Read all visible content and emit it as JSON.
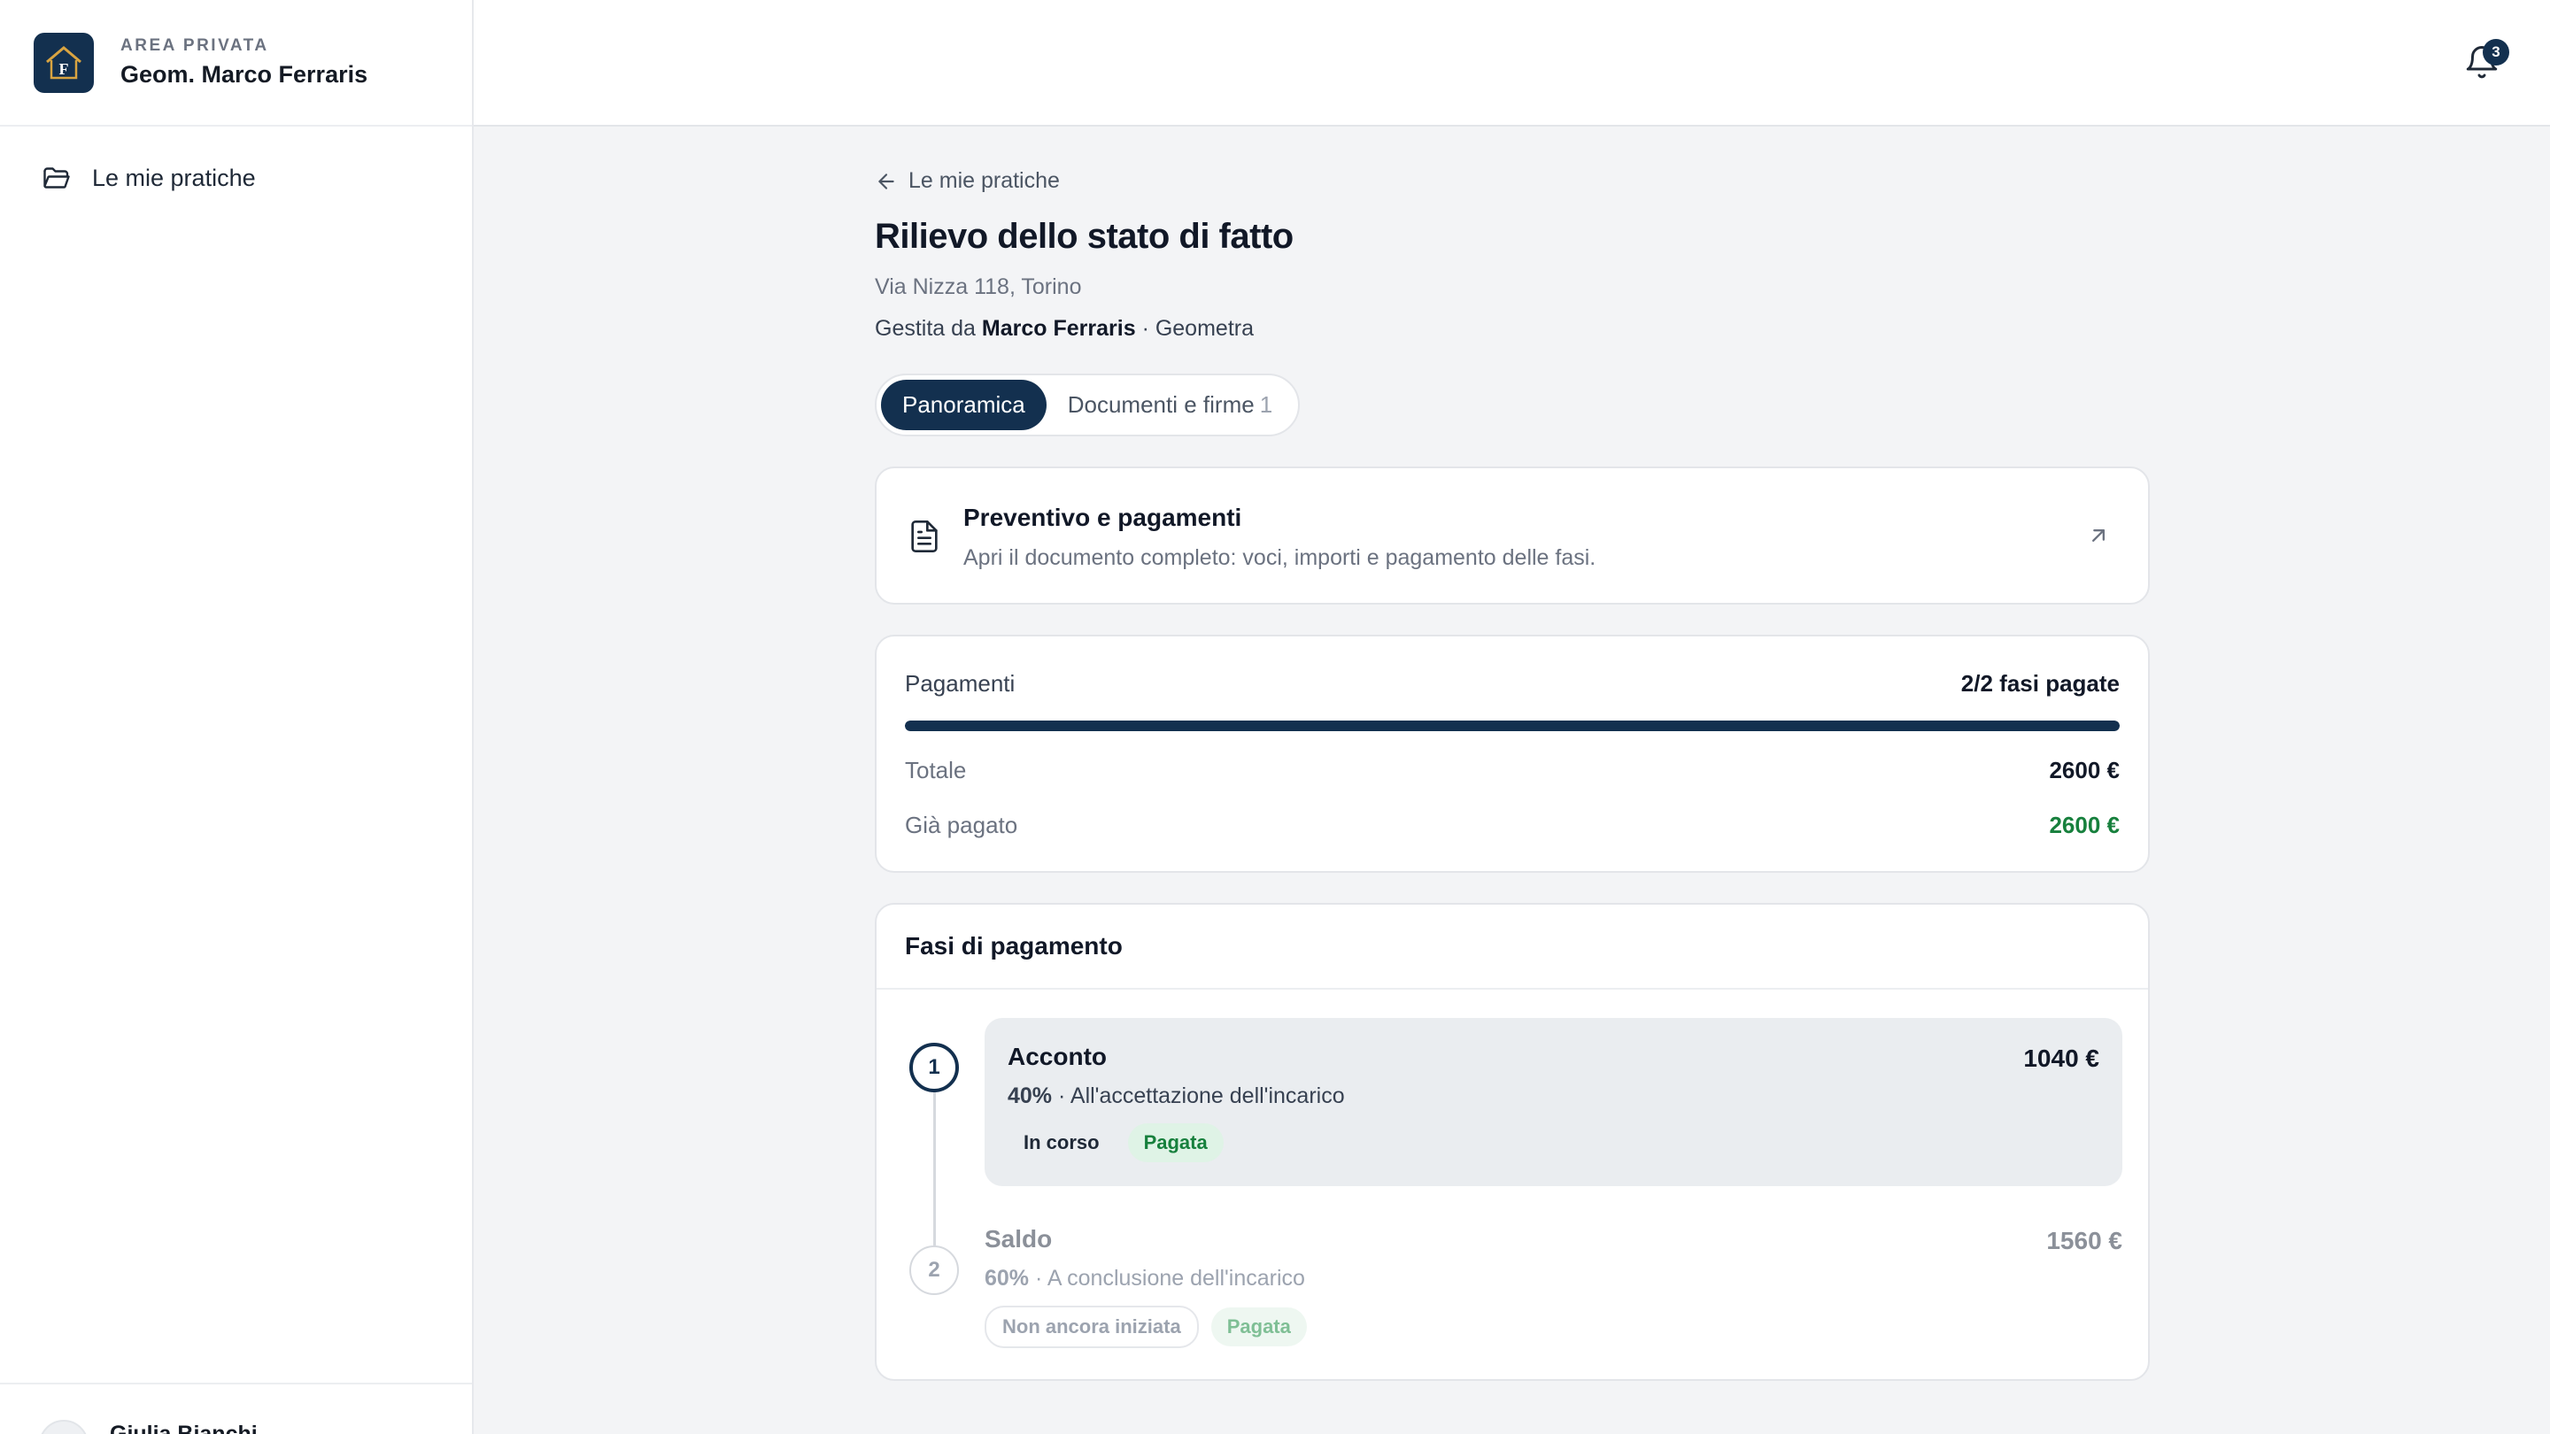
{
  "sidebar": {
    "eyebrow": "AREA PRIVATA",
    "account_name": "Geom. Marco Ferraris",
    "logo_letter": "F",
    "nav": [
      {
        "label": "Le mie pratiche",
        "icon": "folder-open-icon"
      }
    ],
    "user_name": "Giulia Bianchi"
  },
  "topbar": {
    "notifications_count": "3"
  },
  "page": {
    "back_label": "Le mie pratiche",
    "title": "Rilievo dello stato di fatto",
    "address": "Via Nizza 118, Torino",
    "managed_prefix": "Gestita da",
    "managed_name": "Marco Ferraris",
    "managed_role": "· Geometra"
  },
  "tabs": [
    {
      "label": "Panoramica",
      "active": true
    },
    {
      "label": "Documenti e firme",
      "count": "1",
      "active": false
    }
  ],
  "quote_card": {
    "title": "Preventivo e pagamenti",
    "description": "Apri il documento completo: voci, importi e pagamento delle fasi."
  },
  "payments": {
    "label": "Pagamenti",
    "summary": "2/2 fasi pagate",
    "progress_fraction": 1.0,
    "total_label": "Totale",
    "total_value": "2600 €",
    "paid_label": "Già pagato",
    "paid_value": "2600 €"
  },
  "phases": {
    "title": "Fasi di pagamento",
    "items": [
      {
        "number": "1",
        "name": "Acconto",
        "amount": "1040 €",
        "percent": "40%",
        "description": "· All'accettazione dell'incarico",
        "status": "In corso",
        "payment": "Pagata"
      },
      {
        "number": "2",
        "name": "Saldo",
        "amount": "1560 €",
        "percent": "60%",
        "description": "· A conclusione dell'incarico",
        "status": "Non ancora iniziata",
        "payment": "Pagata"
      }
    ]
  },
  "colors": {
    "primary": "#13304f",
    "success": "#17803d",
    "background": "#f3f4f6"
  }
}
